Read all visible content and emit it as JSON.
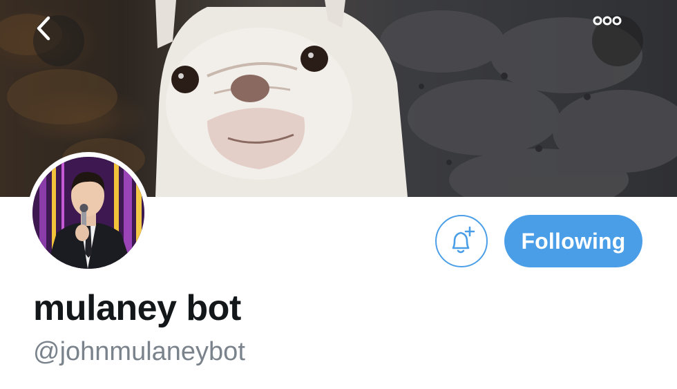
{
  "header": {
    "banner": {
      "description_icon": "banner-image"
    },
    "back_button": {
      "icon": "chevron-left-icon"
    },
    "more_button": {
      "icon": "more-dots-icon"
    }
  },
  "profile": {
    "display_name": "mulaney bot",
    "handle": "@johnmulaneybot",
    "avatar": {
      "icon": "avatar"
    }
  },
  "actions": {
    "notify_button": {
      "icon": "bell-plus-icon"
    },
    "follow_button_label": "Following"
  },
  "colors": {
    "accent": "#4a9ee8",
    "text_primary": "#14171a",
    "text_secondary": "#7a838c",
    "background": "#ffffff"
  }
}
